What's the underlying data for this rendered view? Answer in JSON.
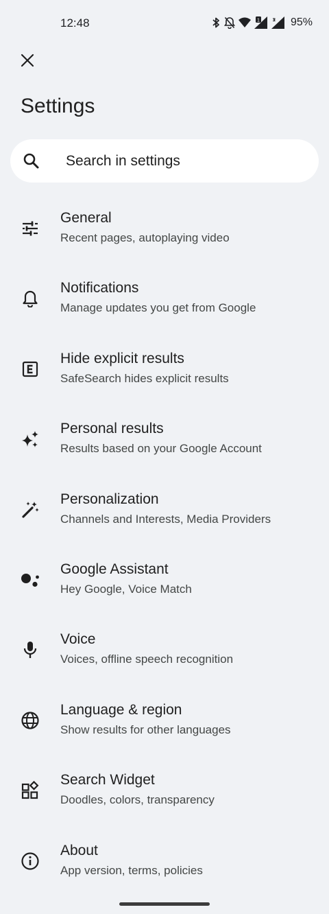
{
  "status_bar": {
    "time": "12:48",
    "battery": "95%",
    "icons": [
      "bluetooth-icon",
      "bell-off-icon",
      "wifi-icon",
      "signal-icon",
      "signal-icon"
    ]
  },
  "header": {
    "close_icon": "close-icon",
    "title": "Settings"
  },
  "search": {
    "placeholder": "Search in settings",
    "icon": "search-icon"
  },
  "items": [
    {
      "title": "General",
      "subtitle": "Recent pages, autoplaying video",
      "icon": "tune-icon"
    },
    {
      "title": "Notifications",
      "subtitle": "Manage updates you get from Google",
      "icon": "bell-icon"
    },
    {
      "title": "Hide explicit results",
      "subtitle": "SafeSearch hides explicit results",
      "icon": "explicit-icon"
    },
    {
      "title": "Personal results",
      "subtitle": "Results based on your Google Account",
      "icon": "sparkle-icon"
    },
    {
      "title": "Personalization",
      "subtitle": "Channels and Interests, Media Providers",
      "icon": "magic-wand-icon"
    },
    {
      "title": "Google Assistant",
      "subtitle": "Hey Google, Voice Match",
      "icon": "assistant-icon"
    },
    {
      "title": "Voice",
      "subtitle": "Voices, offline speech recognition",
      "icon": "microphone-icon"
    },
    {
      "title": "Language & region",
      "subtitle": "Show results for other languages",
      "icon": "globe-icon"
    },
    {
      "title": "Search Widget",
      "subtitle": "Doodles, colors, transparency",
      "icon": "widgets-icon"
    },
    {
      "title": "About",
      "subtitle": "App version, terms, policies",
      "icon": "info-icon"
    }
  ]
}
